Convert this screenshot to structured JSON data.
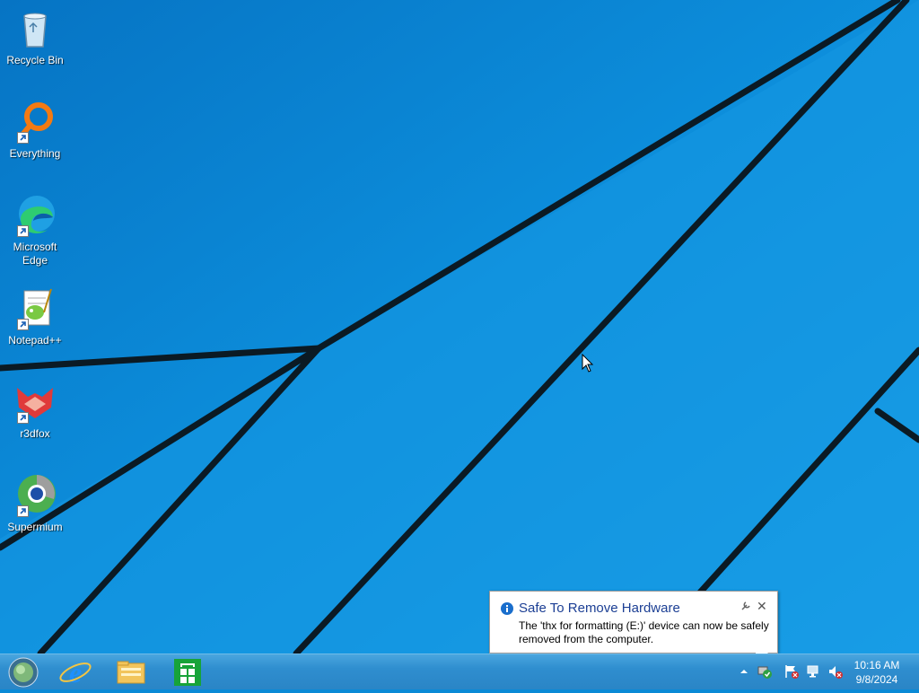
{
  "desktop": {
    "icons": [
      {
        "label": "Recycle Bin",
        "icon": "recycle-bin-icon"
      },
      {
        "label": "Everything",
        "icon": "everything-search-icon"
      },
      {
        "label": "Microsoft\nEdge",
        "icon": "microsoft-edge-icon"
      },
      {
        "label": "Notepad++",
        "icon": "notepad-plus-plus-icon"
      },
      {
        "label": "r3dfox",
        "icon": "r3dfox-icon"
      },
      {
        "label": "Supermium",
        "icon": "supermium-icon"
      }
    ]
  },
  "taskbar": {
    "pinned": [
      "start-orb-icon",
      "internet-explorer-icon",
      "file-explorer-icon",
      "store-icon"
    ],
    "tray": [
      "show-hidden-icons-chevron",
      "safely-remove-hardware-icon",
      "action-center-flag-icon",
      "network-icon",
      "volume-muted-icon"
    ],
    "clock_time": "10:16 AM",
    "clock_date": "9/8/2024"
  },
  "notification": {
    "title": "Safe To Remove Hardware",
    "message": "The 'thx for formatting (E:)' device can now be safely removed from the computer.",
    "icon": "info-icon"
  },
  "colors": {
    "wallpaper_blue": "#0a8ad6",
    "taskbar_blue": "#2f8ecf",
    "balloon_title": "#1c3f94"
  }
}
